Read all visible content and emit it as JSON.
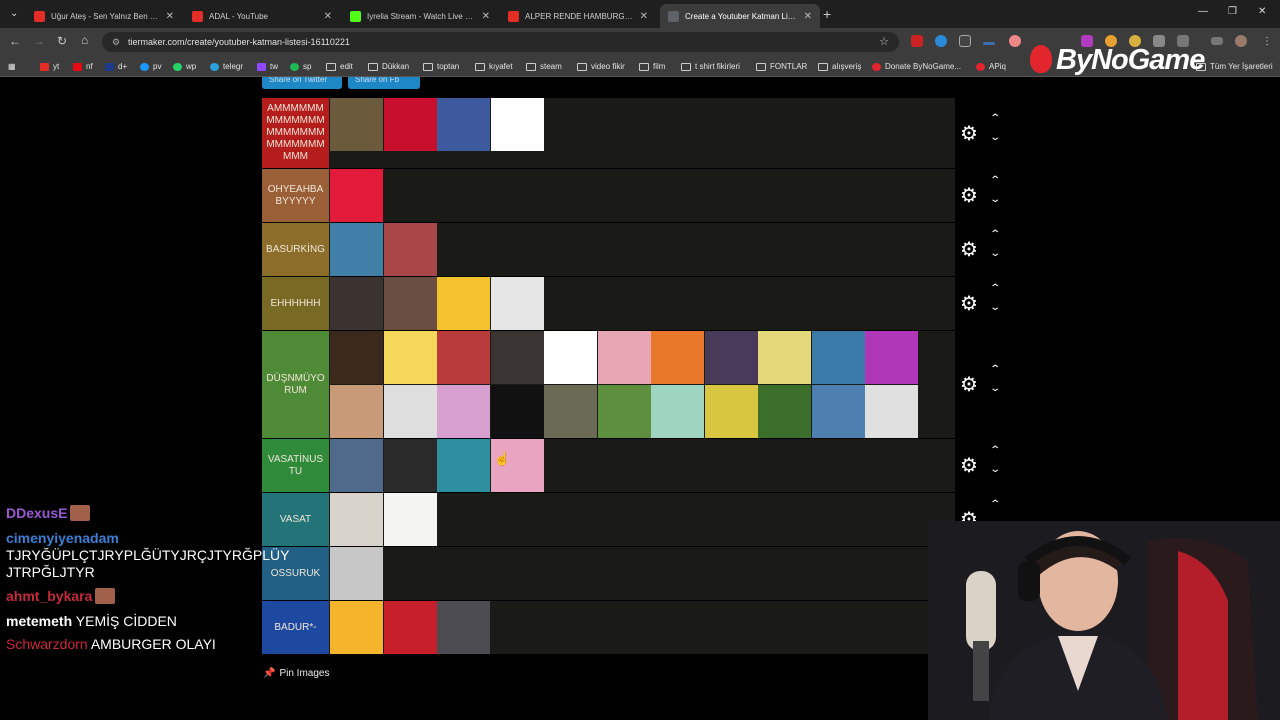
{
  "browser": {
    "tabs": [
      {
        "title": "Uğur Ateş - Sen Yalnız Ben Yalnız",
        "color": "#e52d27",
        "active": false
      },
      {
        "title": "ADAL - YouTube",
        "color": "#e52d27",
        "active": false
      },
      {
        "title": "Iyrelia Stream - Watch Live on Kick",
        "color": "#53fc18",
        "active": false
      },
      {
        "title": "ALPER RENDE HAMBURGER OLAYI",
        "color": "#e52d27",
        "active": false
      },
      {
        "title": "Create a Youtuber Katman Liste",
        "color": "#5f6368",
        "active": true
      }
    ],
    "new_tab_icon": "+",
    "url": "tiermaker.com/create/youtuber-katman-listesi-16110221",
    "bookmarks": [
      {
        "label": "yt",
        "icon": "youtube-icon",
        "color": "#e52d27"
      },
      {
        "label": "nf",
        "icon": "netflix-icon",
        "color": "#e50914"
      },
      {
        "label": "d+",
        "icon": "disney-icon",
        "color": "#1f3a8a"
      },
      {
        "label": "pv",
        "icon": "prime-icon",
        "color": "#1a98ff"
      },
      {
        "label": "wp",
        "icon": "whatsapp-icon",
        "color": "#25d366"
      },
      {
        "label": "telegr",
        "icon": "telegram-icon",
        "color": "#2aa1da"
      },
      {
        "label": "tw",
        "icon": "twitch-icon",
        "color": "#9146ff"
      },
      {
        "label": "sp",
        "icon": "spotify-icon",
        "color": "#1db954"
      },
      {
        "label": "edit",
        "icon": "folder-icon",
        "color": ""
      },
      {
        "label": "Dükkan",
        "icon": "folder-icon",
        "color": ""
      },
      {
        "label": "toptan",
        "icon": "folder-icon",
        "color": ""
      },
      {
        "label": "kıyafet",
        "icon": "folder-icon",
        "color": ""
      },
      {
        "label": "steam",
        "icon": "folder-icon",
        "color": ""
      },
      {
        "label": "video fikir",
        "icon": "folder-icon",
        "color": ""
      },
      {
        "label": "film",
        "icon": "folder-icon",
        "color": ""
      },
      {
        "label": "t shirt fikirleri",
        "icon": "folder-icon",
        "color": ""
      },
      {
        "label": "FONTLAR",
        "icon": "folder-icon",
        "color": ""
      },
      {
        "label": "alışveriş",
        "icon": "folder-icon",
        "color": ""
      },
      {
        "label": "Donate ByNoGame...",
        "icon": "bynogame-icon",
        "color": "#e3262e"
      },
      {
        "label": "APiq",
        "icon": "apiq-icon",
        "color": "#e3262e"
      }
    ],
    "all_bookmarks_label": "Tüm Yer İşaretleri"
  },
  "overlay_brand": "ByNoGame",
  "share_buttons": [
    "Share on Twitter",
    "Share on Fb"
  ],
  "tiers": [
    {
      "label": "AMMMMMMMMMMMMMMMMMMMMMMMMMMMMMM",
      "color": "#b51c1c",
      "items": [
        "#6b5a3c",
        "#c8102e",
        "#3d5a9e",
        "#ffffff"
      ]
    },
    {
      "label": "OHYEAHBABYYYYY",
      "color": "#9a5f36",
      "items": [
        "#e31b3a"
      ]
    },
    {
      "label": "BASURKİNG",
      "color": "#8c6e2a",
      "items": [
        "#3f7fa8",
        "#a84648"
      ]
    },
    {
      "label": "EHHHHHH",
      "color": "#786a24",
      "items": [
        "#3a3330",
        "#6a4d42",
        "#f3c22c",
        "#e6e6e6"
      ]
    },
    {
      "label": "DÜŞNMÜYORUM",
      "color": "#4f8a36",
      "items": [
        "#3b2a1c",
        "#f5d85a",
        "#b93b3b",
        "#3a3433",
        "#ffffff",
        "#e8a6b5",
        "#e9782a",
        "#4a3a5a",
        "#e3d87a",
        "#3a7aa8",
        "#b037b8",
        "#c99a78",
        "#dedede",
        "#d8a0d0",
        "#111111",
        "#6a6a55",
        "#5d8f3e",
        "#9ed4c0",
        "#d9c640",
        "#3b6e2b",
        "#4d7fb0",
        "#e0e0e0"
      ]
    },
    {
      "label": "VASATİNUSTU",
      "color": "#2f8a3a",
      "items": [
        "#4f6a8a",
        "#2a2a2a",
        "#2d8fa0",
        "#e8a4c0"
      ]
    },
    {
      "label": "VASAT",
      "color": "#237478",
      "items": [
        "#d8d4cc",
        "#f4f4f0"
      ]
    },
    {
      "label": "OSSURUK",
      "color": "#225f84",
      "items": [
        "#c7c7c7"
      ]
    },
    {
      "label": "BADUR*-",
      "color": "#1e49a0",
      "items": [
        "#f4b52c",
        "#c8202a",
        "#4c4c52"
      ]
    }
  ],
  "pin_images_label": "Pin Images",
  "chat": [
    {
      "user": "DDexusE",
      "color": "#9b59d6",
      "text": "",
      "emote": true
    },
    {
      "user": "cimenyiyenadam",
      "color": "#3b7fd4",
      "text": "TJRYĞÜPLÇTJRYPLĞÜTYJRÇJTYRĞPLÜY JTRPĞLJTYR",
      "emote": false
    },
    {
      "user": "ahmt_bykara",
      "color": "#c62b3b",
      "text": "",
      "emote": true
    },
    {
      "user": "metemeth",
      "color": "#ffffff",
      "text": "YEMİŞ CİDDEN",
      "emote": false
    },
    {
      "user": "Schwarzdorn",
      "color": "#d0283a",
      "text": "AMBURGER OLAYI",
      "emote": false
    }
  ]
}
